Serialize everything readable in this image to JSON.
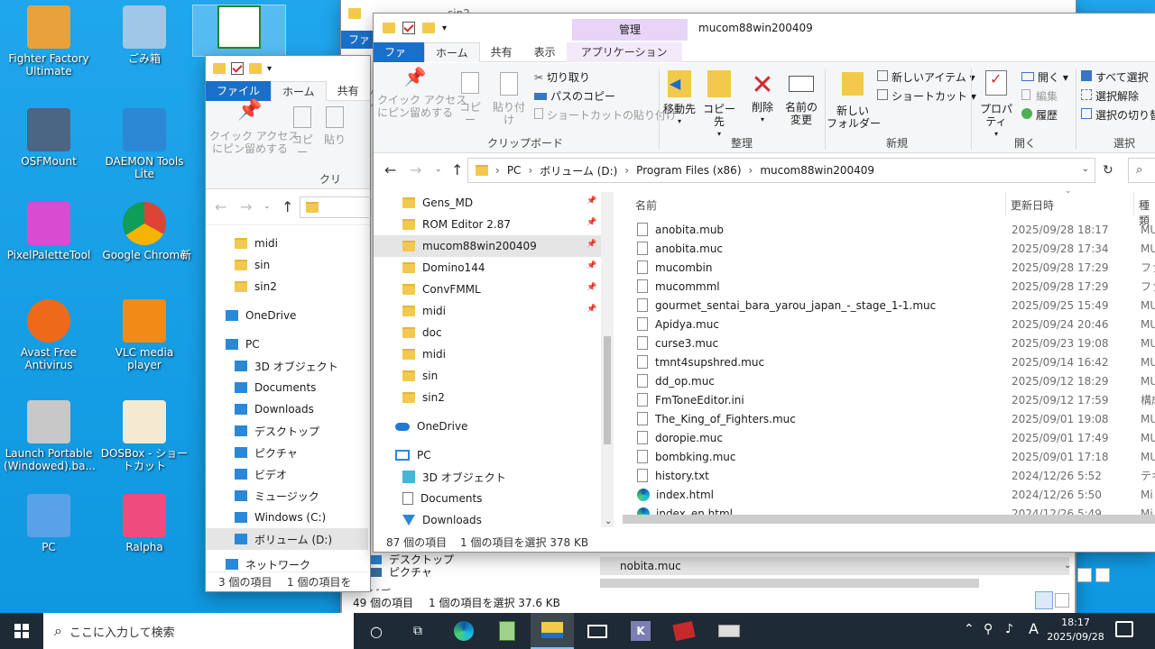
{
  "desktop": {
    "icons": [
      {
        "label": "Fighter Factory Ultimate",
        "icon": "fighter-factory-icon"
      },
      {
        "label": "ごみ箱",
        "icon": "recycle-bin-icon"
      },
      {
        "label": "OSFMount",
        "icon": "osfmount-icon"
      },
      {
        "label": "DAEMON Tools Lite",
        "icon": "daemon-tools-icon"
      },
      {
        "label": "PixelPaletteTool",
        "icon": "pixel-palette-icon"
      },
      {
        "label": "Google Chrome",
        "icon": "chrome-icon"
      },
      {
        "label": "Avast Free Antivirus",
        "icon": "avast-icon"
      },
      {
        "label": "VLC media player",
        "icon": "vlc-icon"
      },
      {
        "label": "Launch Portable (Windowed).ba...",
        "icon": "batch-file-icon"
      },
      {
        "label": "DOSBox - ショートカット",
        "icon": "dosbox-icon"
      },
      {
        "label": "PC",
        "icon": "pc-icon"
      },
      {
        "label": "Ralpha",
        "icon": "ralpha-icon"
      }
    ],
    "partial_label": "新"
  },
  "back_window": {
    "title": "sin2",
    "tab_file": "ファイル",
    "partial_text": "クイック ア\nにピン留"
  },
  "mid_window": {
    "tabs": {
      "file": "ファイル",
      "home": "ホーム",
      "share": "共有"
    },
    "ribbon": {
      "quick_access": "クイック アクセス\nにピン留めする",
      "copy": "コピー",
      "paste": "貼り",
      "group": "クリ"
    },
    "address_partial": "",
    "nav": {
      "folders": [
        "midi",
        "sin",
        "sin2"
      ],
      "onedrive": "OneDrive",
      "pc": "PC",
      "pc_items": [
        "3D オブジェクト",
        "Documents",
        "Downloads",
        "デスクトップ",
        "ピクチャ",
        "ビデオ",
        "ミュージック",
        "Windows (C:)",
        "ボリューム (D:)"
      ],
      "network": "ネットワーク"
    },
    "status": {
      "count": "3 個の項目",
      "selected": "1 個の項目を"
    }
  },
  "sin_window": {
    "title": "sin2",
    "tab_file": "ファイル",
    "file_bottom": "nobita.muc",
    "nav": [
      "デスクトップ",
      "ピクチャ",
      "ビデオ"
    ],
    "status": {
      "count": "49 個の項目",
      "selected": "1 個の項目を選択  37.6 KB"
    }
  },
  "main_window": {
    "title": "mucom88win200409",
    "context_tab_header": "管理",
    "tabs": {
      "file": "ファイル",
      "home": "ホーム",
      "share": "共有",
      "view": "表示",
      "app_tools": "アプリケーション ツール"
    },
    "ribbon": {
      "clipboard": {
        "pin": "クイック アクセス\nにピン留めする",
        "copy": "コピー",
        "paste": "貼り付け",
        "cut": "切り取り",
        "copy_path": "パスのコピー",
        "paste_shortcut": "ショートカットの貼り付け",
        "label": "クリップボード"
      },
      "organize": {
        "move": "移動先",
        "copy_to": "コピー先",
        "delete": "削除",
        "rename": "名前の\n変更",
        "label": "整理"
      },
      "new": {
        "new_folder": "新しい\nフォルダー",
        "new_item": "新しいアイテム",
        "shortcut": "ショートカット",
        "label": "新規"
      },
      "open": {
        "properties": "プロパティ",
        "open": "開く",
        "edit": "編集",
        "history": "履歴",
        "label": "開く"
      },
      "select": {
        "select_all": "すべて選択",
        "select_none": "選択解除",
        "invert": "選択の切り替",
        "label": "選択"
      }
    },
    "address": {
      "crumbs": [
        "PC",
        "ボリューム (D:)",
        "Program Files (x86)",
        "mucom88win200409"
      ],
      "search_placeholder": ""
    },
    "nav": {
      "quick": [
        {
          "label": "Gens_MD",
          "pinned": true
        },
        {
          "label": "ROM Editor 2.87",
          "pinned": true
        },
        {
          "label": "mucom88win200409",
          "pinned": true,
          "selected": true
        },
        {
          "label": "Domino144",
          "pinned": true
        },
        {
          "label": "ConvFMML",
          "pinned": true
        },
        {
          "label": "midi",
          "pinned": true
        },
        {
          "label": "doc",
          "pinned": false
        },
        {
          "label": "midi",
          "pinned": false
        },
        {
          "label": "sin",
          "pinned": false
        },
        {
          "label": "sin2",
          "pinned": false
        }
      ],
      "onedrive": "OneDrive",
      "pc": "PC",
      "pc_items": [
        "3D オブジェクト",
        "Documents",
        "Downloads"
      ]
    },
    "columns": {
      "name": "名前",
      "modified": "更新日時",
      "type": "種類"
    },
    "files": [
      {
        "name": "anobita.mub",
        "date": "2025/09/28 18:17",
        "type": "MU",
        "icon": "file"
      },
      {
        "name": "anobita.muc",
        "date": "2025/09/28 17:34",
        "type": "MU",
        "icon": "file"
      },
      {
        "name": "mucombin",
        "date": "2025/09/28 17:29",
        "type": "ファ",
        "icon": "file"
      },
      {
        "name": "mucommml",
        "date": "2025/09/28 17:29",
        "type": "ファ",
        "icon": "file"
      },
      {
        "name": "gourmet_sentai_bara_yarou_japan_-_stage_1-1.muc",
        "date": "2025/09/25 15:49",
        "type": "MU",
        "icon": "file"
      },
      {
        "name": "Apidya.muc",
        "date": "2025/09/24 20:46",
        "type": "MU",
        "icon": "file"
      },
      {
        "name": "curse3.muc",
        "date": "2025/09/23 19:08",
        "type": "MU",
        "icon": "file"
      },
      {
        "name": "tmnt4supshred.muc",
        "date": "2025/09/14 16:42",
        "type": "MU",
        "icon": "file"
      },
      {
        "name": "dd_op.muc",
        "date": "2025/09/12 18:29",
        "type": "MU",
        "icon": "file"
      },
      {
        "name": "FmToneEditor.ini",
        "date": "2025/09/12 17:59",
        "type": "構成",
        "icon": "ini"
      },
      {
        "name": "The_King_of_Fighters.muc",
        "date": "2025/09/01 19:08",
        "type": "MU",
        "icon": "file"
      },
      {
        "name": "doropie.muc",
        "date": "2025/09/01 17:49",
        "type": "MU",
        "icon": "file"
      },
      {
        "name": "bombking.muc",
        "date": "2025/09/01 17:18",
        "type": "MU",
        "icon": "file"
      },
      {
        "name": "history.txt",
        "date": "2024/12/26 5:52",
        "type": "テキ",
        "icon": "file"
      },
      {
        "name": "index.html",
        "date": "2024/12/26 5:50",
        "type": "Mi",
        "icon": "edge"
      },
      {
        "name": "index_en.html",
        "date": "2024/12/26 5:49",
        "type": "Mi",
        "icon": "edge"
      }
    ],
    "status": {
      "count": "87 個の項目",
      "selected": "1 個の項目を選択  378 KB"
    }
  },
  "taskbar": {
    "search_placeholder": "ここに入力して検索",
    "time": "18:17",
    "date": "2025/09/28",
    "ime": "A"
  }
}
